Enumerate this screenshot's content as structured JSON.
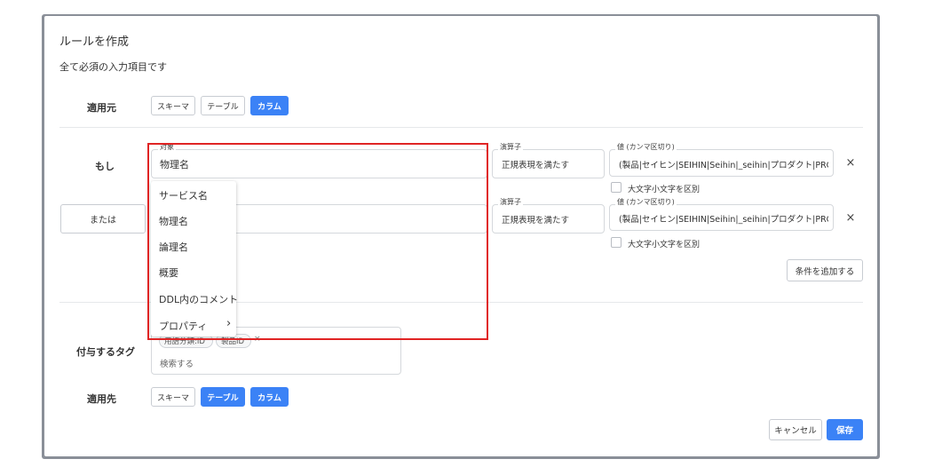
{
  "dialog": {
    "title": "ルールを作成",
    "description": "全て必須の入力項目です"
  },
  "apply_from": {
    "label": "適用元",
    "options": [
      "スキーマ",
      "テーブル",
      "カラム"
    ],
    "selected": [
      "カラム"
    ]
  },
  "conditions": [
    {
      "connector": "もし",
      "target_label": "対象",
      "target_value": "物理名",
      "operator_label": "演算子",
      "operator_value": "正規表現を満たす",
      "value_label": "値 (カンマ区切り)",
      "value_value": "(製品|セイヒン|SEIHIN|Seihin|_seihin|プロダクト|PROI",
      "case_label": "大文字小文字を区別",
      "case_checked": false
    },
    {
      "connector": "または",
      "target_label": "",
      "target_value": "",
      "operator_label": "演算子",
      "operator_value": "正規表現を満たす",
      "value_label": "値 (カンマ区切り)",
      "value_value": "(製品|セイヒン|SEIHIN|Seihin|_seihin|プロダクト|PROI",
      "case_label": "大文字小文字を区別",
      "case_checked": false
    }
  ],
  "add_condition_label": "条件を追加する",
  "target_dropdown": {
    "items": [
      "サービス名",
      "物理名",
      "論理名",
      "概要",
      "DDL内のコメント",
      "プロパティ"
    ],
    "submenu_indicator": "›"
  },
  "tags": {
    "label": "付与するタグ",
    "chips": [
      "用語分類:ID",
      "製品ID"
    ],
    "chip_remove": "×",
    "search_placeholder": "検索する"
  },
  "apply_to": {
    "label": "適用先",
    "options": [
      "スキーマ",
      "テーブル",
      "カラム"
    ],
    "selected": [
      "テーブル",
      "カラム"
    ]
  },
  "footer": {
    "cancel_label": "キャンセル",
    "save_label": "保存"
  },
  "icons": {
    "close": "×"
  },
  "colors": {
    "primary": "#3b82f6",
    "highlight": "#e02424"
  }
}
